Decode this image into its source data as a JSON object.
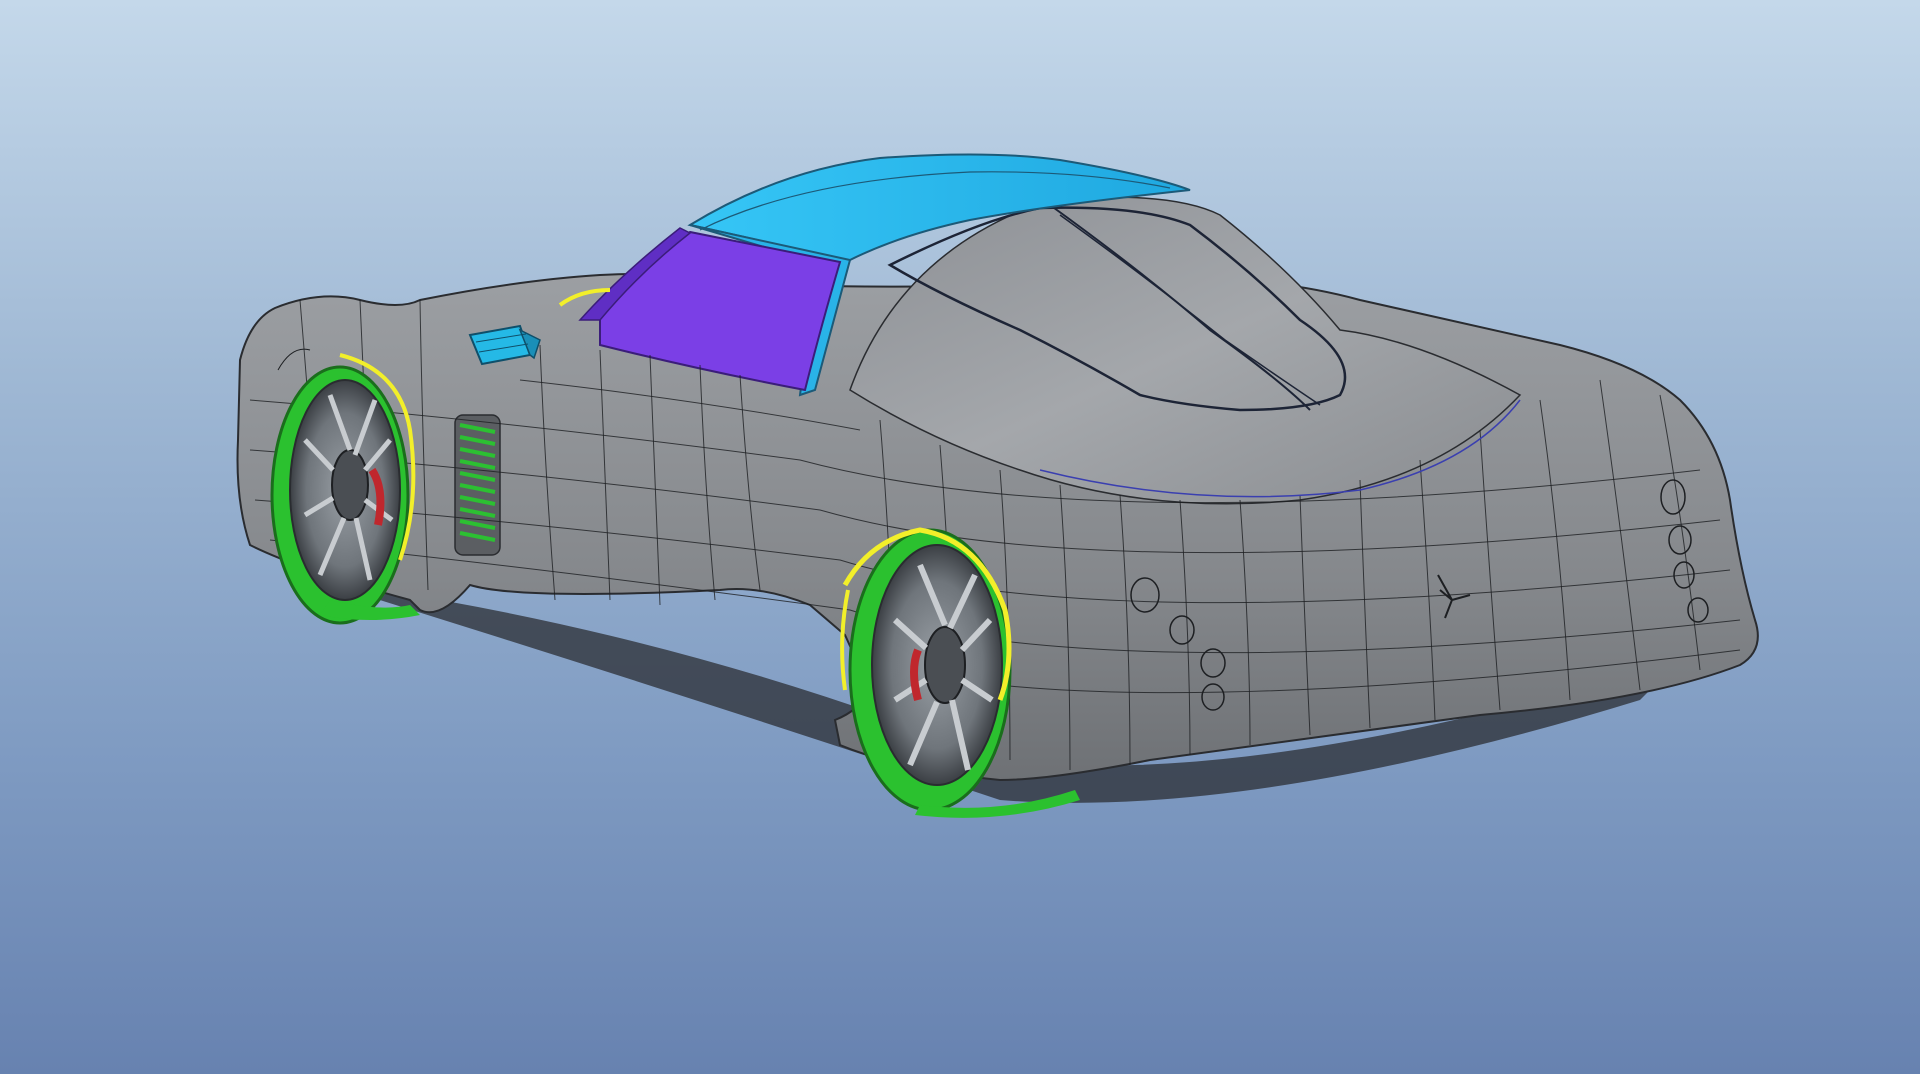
{
  "viewport": {
    "background_top": "#c4d8ea",
    "background_bottom": "#6782b0"
  },
  "model": {
    "name": "",
    "body_color": "#8a8c8f",
    "mesh_line_color": "#1d1f22",
    "roof_color": "#2ab7ec",
    "side_window_color": "#7b3fe6",
    "tire_color": "#2bc12f",
    "fender_lip_color": "#f2ef2a",
    "rim_color": "#7d8186",
    "brake_caliper_color": "#c0272d",
    "mirror_color": "#25b9e6",
    "spring_color": "#2cc032",
    "icons": [
      "car-body-icon",
      "wheel-icon",
      "mirror-icon",
      "coil-spring-icon"
    ]
  }
}
